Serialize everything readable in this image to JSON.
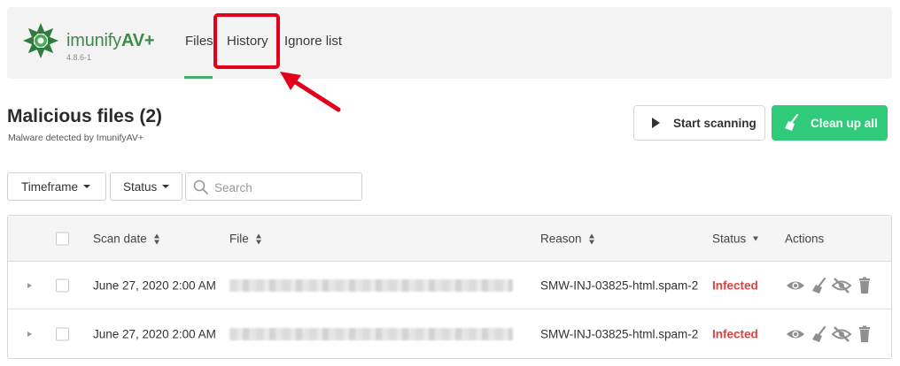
{
  "header": {
    "brand_name": "imunify",
    "brand_suffix": "AV+",
    "version": "4.8.6-1",
    "tabs": [
      {
        "label": "Files",
        "active": true
      },
      {
        "label": "History",
        "active": false
      },
      {
        "label": "Ignore list",
        "active": false
      }
    ]
  },
  "page": {
    "title": "Malicious files (2)",
    "subtitle": "Malware detected by ImunifyAV+"
  },
  "buttons": {
    "start_scanning": "Start scanning",
    "clean_up_all": "Clean up all"
  },
  "filters": {
    "timeframe": "Timeframe",
    "status": "Status",
    "search_placeholder": "Search"
  },
  "table": {
    "columns": [
      "Scan date",
      "File",
      "Reason",
      "Status",
      "Actions"
    ],
    "rows": [
      {
        "scan_date": "June 27, 2020 2:00 AM",
        "file": "",
        "reason": "SMW-INJ-03825-html.spam-2",
        "status": "Infected"
      },
      {
        "scan_date": "June 27, 2020 2:00 AM",
        "file": "",
        "reason": "SMW-INJ-03825-html.spam-2",
        "status": "Infected"
      }
    ]
  },
  "colors": {
    "brand_green": "#3d8b49",
    "tab_underline": "#3fae6a",
    "primary_button": "#2fca7a",
    "infected_red": "#e43f3f",
    "highlight_red": "#e3001b"
  },
  "icons": [
    "imunify-logo-icon",
    "play-icon",
    "broom-icon",
    "search-icon",
    "sort-icon",
    "eye-icon",
    "clean-icon",
    "ignore-icon",
    "trash-icon",
    "expand-icon",
    "arrow-annotation-icon"
  ]
}
